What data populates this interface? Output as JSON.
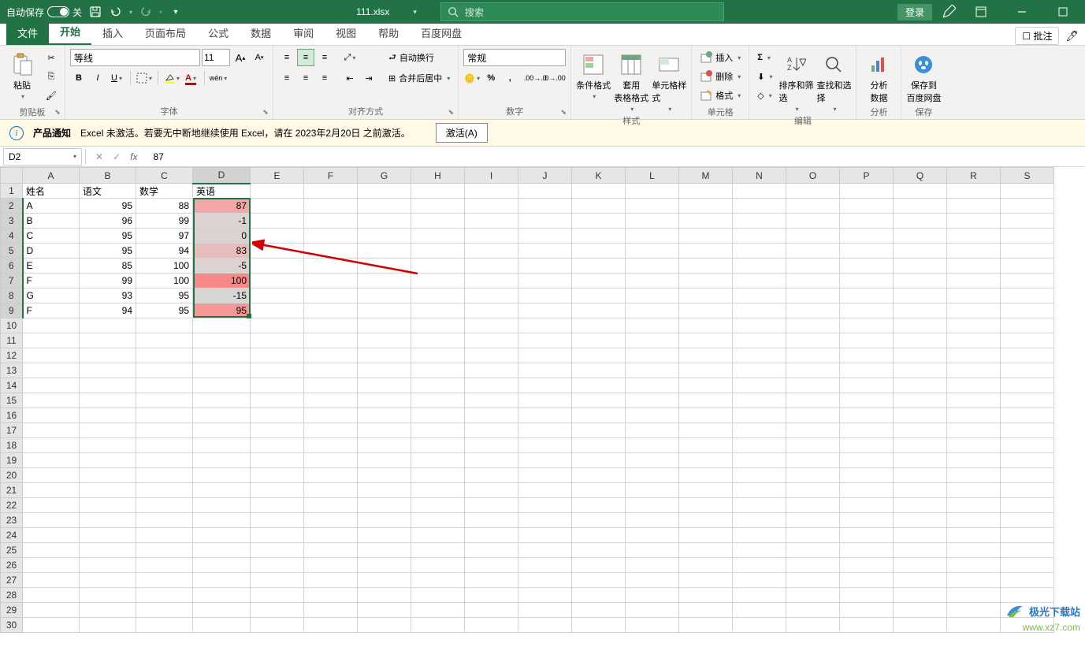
{
  "title_bar": {
    "autosave_label": "自动保存",
    "autosave_state": "关",
    "filename": "111.xlsx",
    "search_placeholder": "搜索",
    "login_label": "登录"
  },
  "tabs": {
    "file": "文件",
    "home": "开始",
    "insert": "插入",
    "layout": "页面布局",
    "formulas": "公式",
    "data": "数据",
    "review": "审阅",
    "view": "视图",
    "help": "帮助",
    "baidu": "百度网盘",
    "comments": "批注"
  },
  "ribbon": {
    "clipboard": {
      "paste": "粘贴",
      "label": "剪贴板"
    },
    "font": {
      "name": "等线",
      "size": "11",
      "label": "字体",
      "wen": "wén"
    },
    "align": {
      "wrap": "自动换行",
      "merge": "合并后居中",
      "label": "对齐方式"
    },
    "number": {
      "format": "常规",
      "label": "数字"
    },
    "styles": {
      "cond": "条件格式",
      "table": "套用\n表格格式",
      "cell": "单元格样式",
      "label": "样式"
    },
    "cells": {
      "insert": "插入",
      "delete": "删除",
      "format": "格式",
      "label": "单元格"
    },
    "editing": {
      "sort": "排序和筛选",
      "find": "查找和选择",
      "label": "编辑"
    },
    "analysis": {
      "analyze": "分析\n数据",
      "label": "分析"
    },
    "save": {
      "baidu": "保存到\n百度网盘",
      "label": "保存"
    }
  },
  "notify": {
    "title": "产品通知",
    "message": "Excel 未激活。若要无中断地继续使用 Excel，请在 2023年2月20日 之前激活。",
    "activate": "激活(A)"
  },
  "formula_bar": {
    "name_box": "D2",
    "formula": "87"
  },
  "columns": [
    "A",
    "B",
    "C",
    "D",
    "E",
    "F",
    "G",
    "H",
    "I",
    "J",
    "K",
    "L",
    "M",
    "N",
    "O",
    "P",
    "Q",
    "R",
    "S"
  ],
  "row_count": 30,
  "headers": {
    "c1": "姓名",
    "c2": "语文",
    "c3": "数学",
    "c4": "英语"
  },
  "data_rows": [
    {
      "name": "A",
      "yw": "95",
      "sx": "88",
      "yy": "87",
      "cf": "cf-high"
    },
    {
      "name": "B",
      "yw": "96",
      "sx": "99",
      "yy": "-1",
      "cf": "cf-low"
    },
    {
      "name": "C",
      "yw": "95",
      "sx": "97",
      "yy": "0",
      "cf": "cf-low"
    },
    {
      "name": "D",
      "yw": "95",
      "sx": "94",
      "yy": "83",
      "cf": "cf-mid"
    },
    {
      "name": "E",
      "yw": "85",
      "sx": "100",
      "yy": "-5",
      "cf": "cf-low"
    },
    {
      "name": "F",
      "yw": "99",
      "sx": "100",
      "yy": "100",
      "cf": "cf-highest"
    },
    {
      "name": "G",
      "yw": "93",
      "sx": "95",
      "yy": "-15",
      "cf": "cf-lowest"
    },
    {
      "name": "F",
      "yw": "94",
      "sx": "95",
      "yy": "95",
      "cf": "cf-near-max"
    }
  ],
  "watermark": {
    "text": "极光下载站",
    "url": "www.xz7.com"
  }
}
